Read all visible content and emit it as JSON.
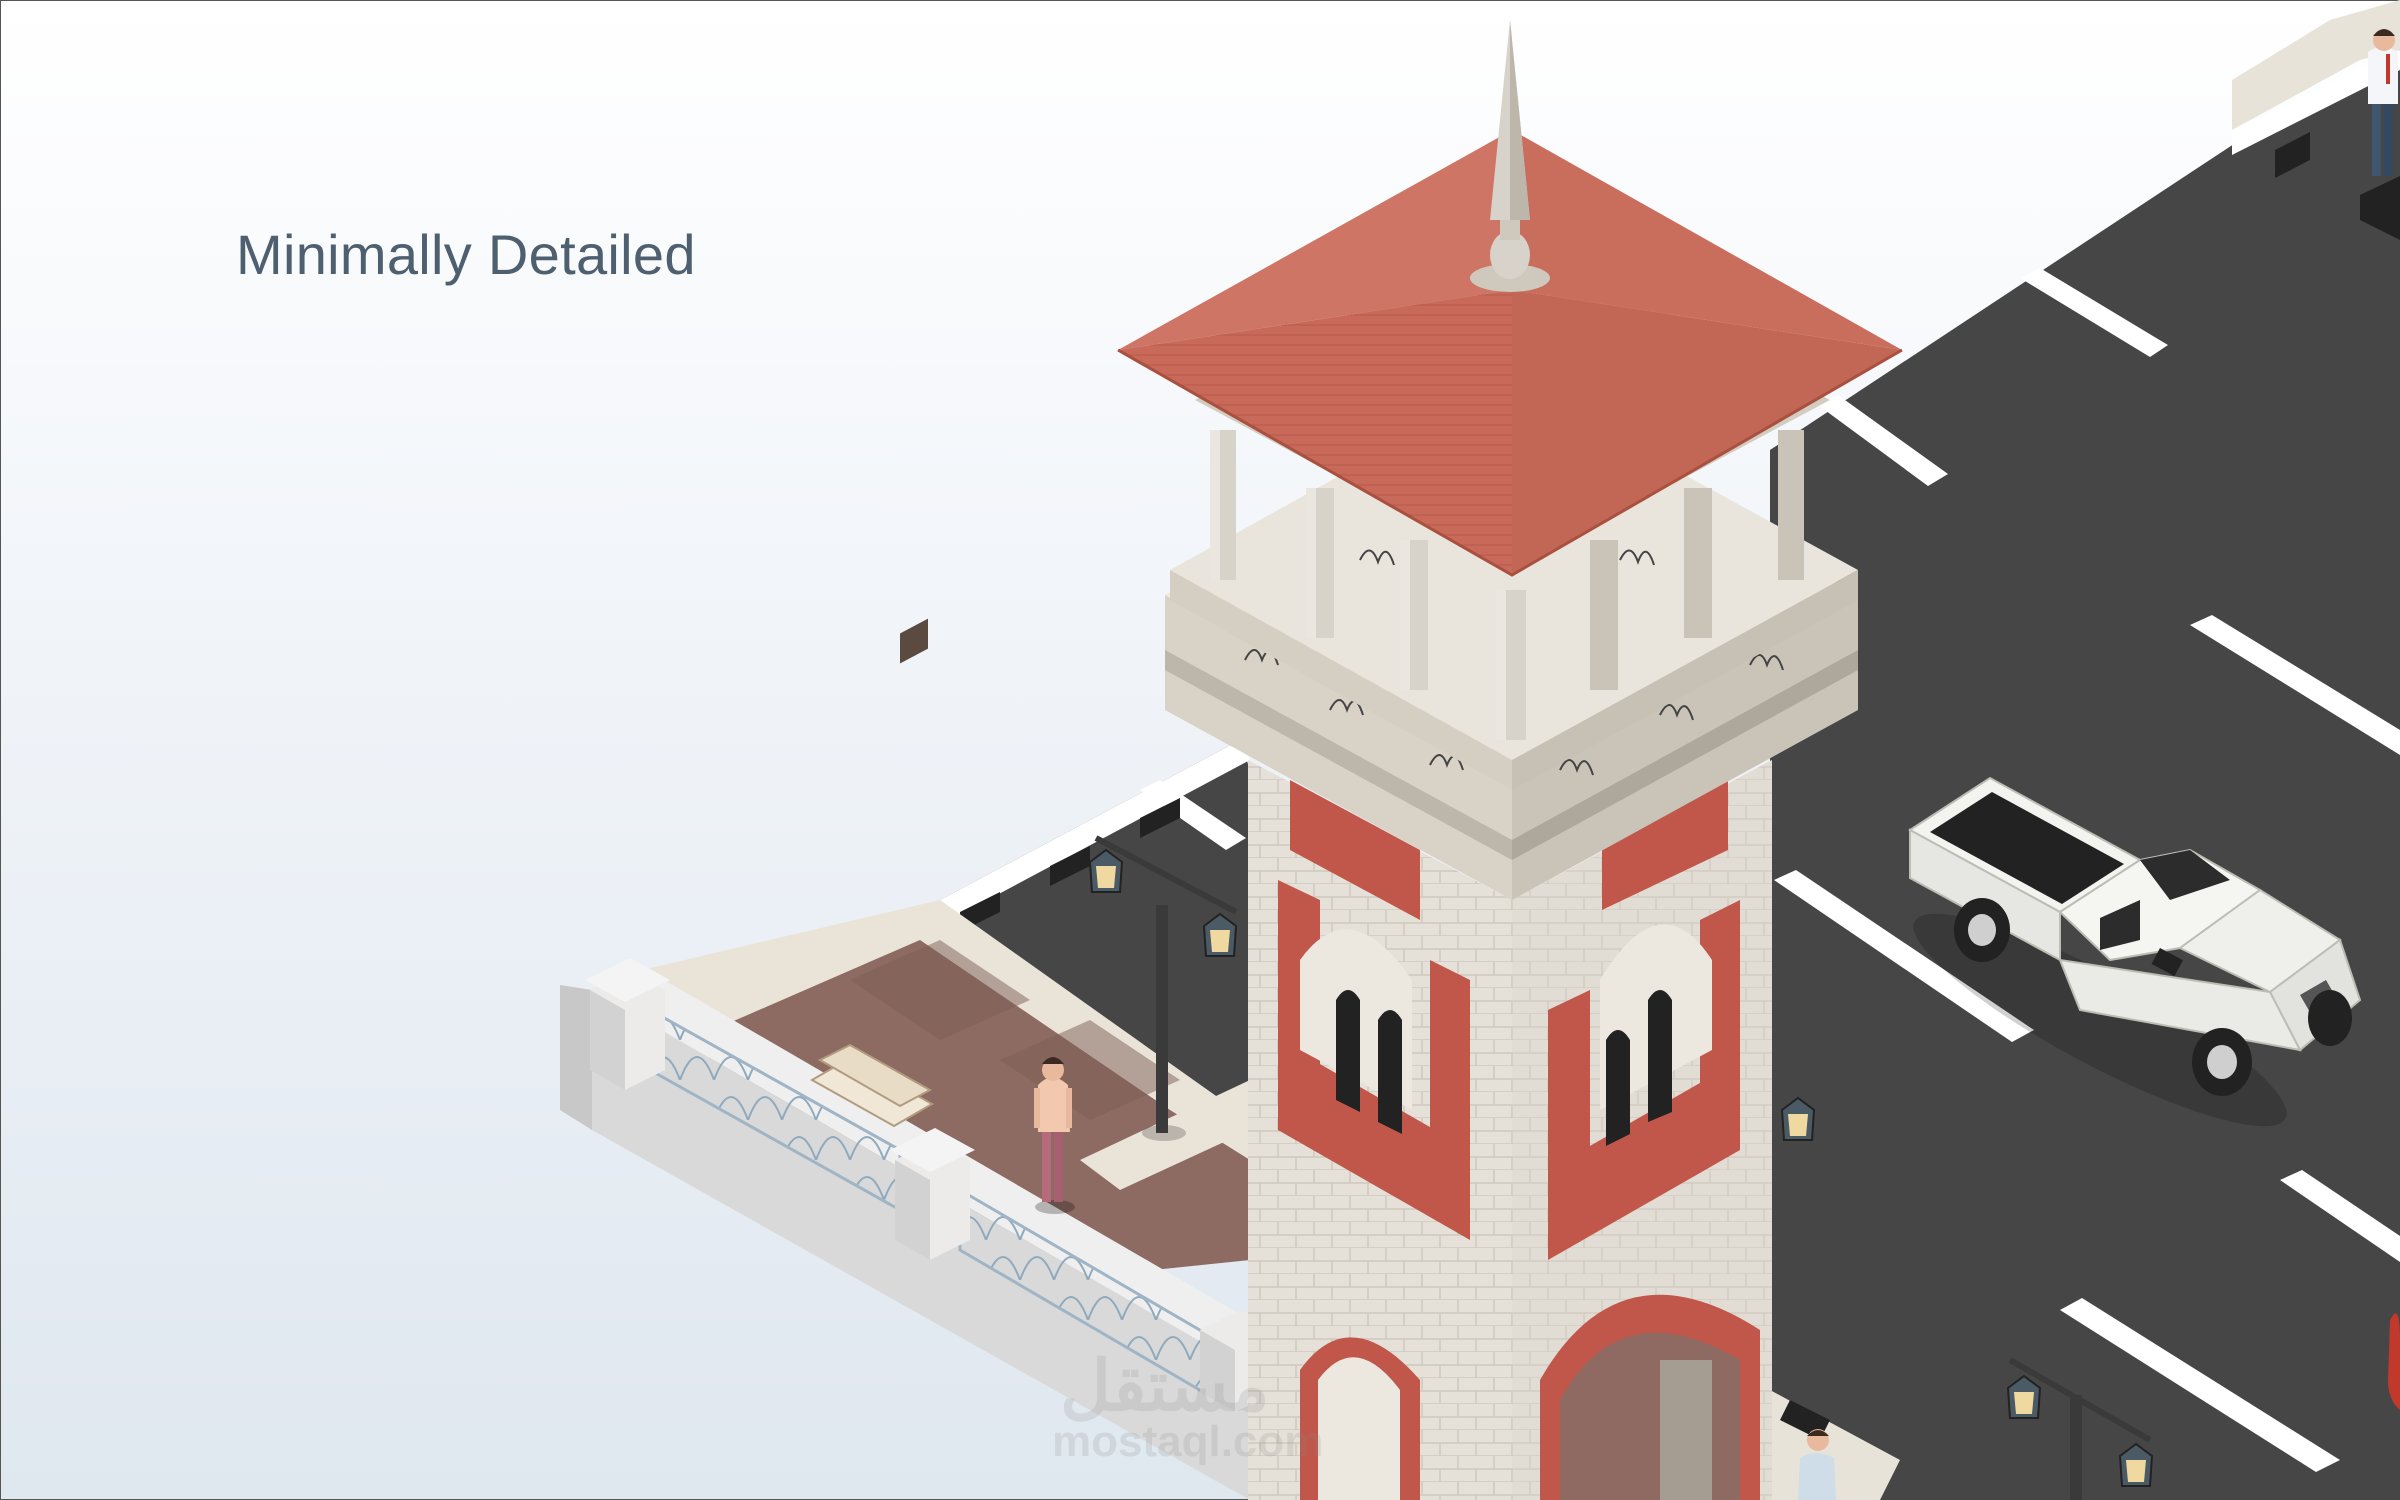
{
  "heading": "Minimally Detailed",
  "watermark": {
    "arabic": "مستقل",
    "latin": "mostaql.com"
  },
  "palette": {
    "roof": "#c9695a",
    "brick": "#c0574a",
    "stone": "#e4dfd6",
    "road": "#474747",
    "road_marking": "#ffffff",
    "plaza": "#8e6a62",
    "truck": "#f2f2ef"
  },
  "icons": [
    "tower",
    "pickup-truck-icon",
    "street-lamp-icon",
    "bench-icon",
    "person-icon"
  ]
}
